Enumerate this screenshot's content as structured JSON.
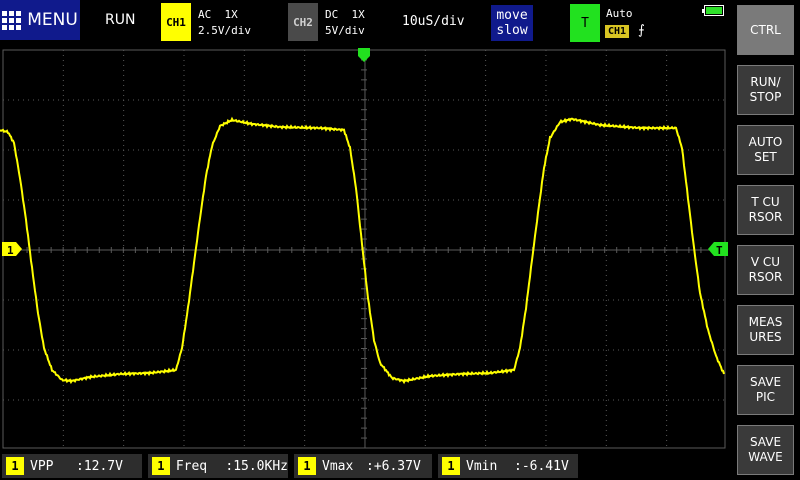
{
  "topbar": {
    "menu_label": "MENU",
    "run_state": "RUN",
    "ch1": {
      "label": "CH1",
      "coupling": "AC  1X",
      "scale": "2.5V/div"
    },
    "ch2": {
      "label": "CH2",
      "coupling": "DC  1X",
      "scale": "5V/div"
    },
    "timebase": "10uS/div",
    "move": {
      "line1": "move",
      "line2": "slow"
    },
    "trigger": {
      "label": "T",
      "mode": "Auto",
      "source": "CH1",
      "edge": "⨍"
    }
  },
  "screen": {
    "ch1_marker": "1",
    "trigger_marker": "T",
    "trace_color": "#ffff00",
    "grid_color": "#5a5a5a"
  },
  "sidebar": {
    "buttons": [
      {
        "line1": "CTRL",
        "line2": ""
      },
      {
        "line1": "RUN/",
        "line2": "STOP"
      },
      {
        "line1": "AUTO",
        "line2": "SET"
      },
      {
        "line1": "T CU",
        "line2": "RSOR"
      },
      {
        "line1": "V CU",
        "line2": "RSOR"
      },
      {
        "line1": "MEAS",
        "line2": "URES"
      },
      {
        "line1": "SAVE",
        "line2": "PIC"
      },
      {
        "line1": "SAVE",
        "line2": "WAVE"
      }
    ]
  },
  "measurements": [
    {
      "channel": "1",
      "label": "VPP",
      "value": ":12.7V"
    },
    {
      "channel": "1",
      "label": "Freq",
      "value": ":15.0KHz"
    },
    {
      "channel": "1",
      "label": "Vmax",
      "value": ":+6.37V"
    },
    {
      "channel": "1",
      "label": "Vmin",
      "value": ":-6.41V"
    }
  ]
}
